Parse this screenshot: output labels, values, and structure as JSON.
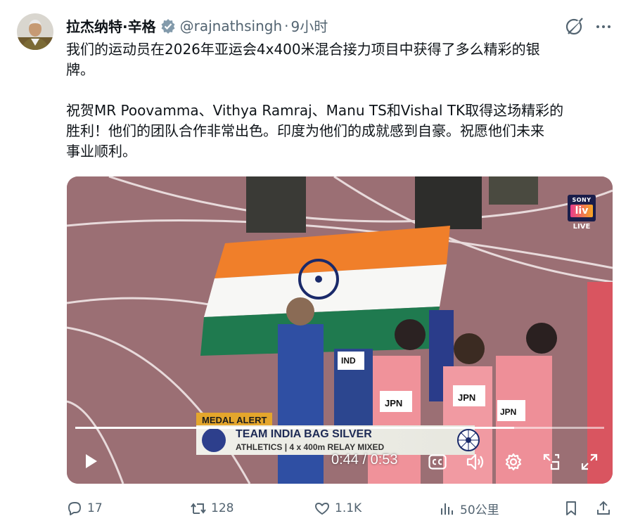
{
  "author": {
    "name": "拉杰纳特·辛格",
    "handle": "@rajnathsingh",
    "separator": "·",
    "time": "9小时",
    "verified": true
  },
  "tweet": {
    "line1": "我们的运动员在2026年亚运会4x400米混合接力项目中获得了多么精彩的银",
    "line2": "牌。",
    "line3": "祝贺MR Poovamma、Vithya Ramraj、Manu TS和Vishal TK取得这场精彩的",
    "line4": "胜利！他们的团队合作非常出色。印度为他们的成就感到自豪。祝愿他们未来",
    "line5": "事业顺利。"
  },
  "video": {
    "broadcaster_line1": "SONY",
    "broadcaster_line2": "liv",
    "live_label": "LIVE",
    "medal_alert": "MEDAL ALERT",
    "banner_headline": "TEAM INDIA BAG SILVER",
    "banner_sub": "ATHLETICS | 4 x 400m RELAY MIXED",
    "bibs": [
      "JPN",
      "JPN",
      "JPN",
      "IND"
    ],
    "current_time": "0:44",
    "time_separator": "/",
    "duration": "0:53",
    "progress": 0.83
  },
  "actions": {
    "replies": "17",
    "retweets": "128",
    "likes": "1.1K",
    "views": "50公里"
  },
  "colors": {
    "verified": "#829aab",
    "muted": "#536471",
    "saffron": "#f07f2a",
    "india_green": "#1f7a4f",
    "track": "#9b6f74"
  },
  "icons": [
    "verified-badge-icon",
    "grok-icon",
    "more-icon",
    "play-icon",
    "captions-icon",
    "volume-icon",
    "settings-gear-icon",
    "pip-icon",
    "fullscreen-icon",
    "reply-icon",
    "retweet-icon",
    "like-icon",
    "views-icon",
    "bookmark-icon",
    "share-icon"
  ]
}
